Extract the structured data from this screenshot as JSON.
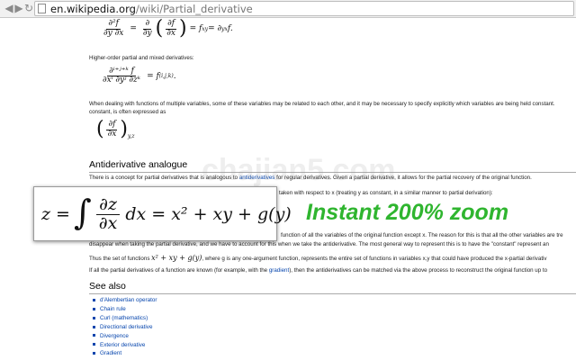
{
  "browser": {
    "url_host": "en.wikipedia.org",
    "url_path": "/wiki/Partial_derivative"
  },
  "article": {
    "eq1": {
      "d2f": "∂²f",
      "dydx": "∂y ∂x",
      "eq_sign": "=",
      "d": "∂",
      "dy": "∂y",
      "df": "∂f",
      "dx": "∂x",
      "rest": "= f",
      "sub1": "xy",
      "rest2": " = ∂",
      "sub2": "yx",
      "end": "f."
    },
    "higher_order_text": "Higher-order partial and mixed derivatives:",
    "eq2": {
      "num": "∂ⁱ⁺ʲ⁺ᵏ f",
      "den": "∂xⁱ ∂yʲ ∂zᵏ",
      "rhs": "= f",
      "sup": "(i,j,k)",
      "end": "."
    },
    "multivar_text_1": "When dealing with functions of multiple variables, some of these variables may be related to each other, and it may be necessary to specify explicitly which variables are being held constant.",
    "multivar_text_2": "constant, is often expressed as",
    "eq3": {
      "num": "∂f",
      "den": "∂x",
      "sub": "y,z"
    },
    "antiderivative_heading": "Antiderivative analogue",
    "anti_text_1_pre": "There is a concept for partial derivatives that is analogous to ",
    "anti_text_1_link": "antiderivatives",
    "anti_text_1_post": " for regular derivatives. Given a partial derivative, it allows for the partial recovery of the original function.",
    "anti_text_2": "taken with respect to x (treating y as constant, in a similar manner to partial derivation):",
    "anti_text_3": "function of all the variables of the original function except x. The reason for this is that all the other variables are tre",
    "anti_text_4": "disappear when taking the partial derivative, and we have to account for this when we take the antiderivative. The most general way to represent this is to have the \"constant\" represent an",
    "thus_pre": "Thus the set of functions ",
    "thus_math": "x² + xy + g(y)",
    "thus_post": ", where g is any one-argument function, represents the entire set of functions in variables x,y that could have produced the x-partial derivativ",
    "known_pre": "If all the partial derivatives of a function are known (for example, with the ",
    "known_link": "gradient",
    "known_post": "), then the antiderivatives can be matched via the above process to reconstruct the original function up to",
    "see_also_heading": "See also",
    "see_also": [
      "d'Alembertian operator",
      "Chain rule",
      "Curl (mathematics)",
      "Directional derivative",
      "Divergence",
      "Exterior derivative",
      "Gradient"
    ]
  },
  "zoom_overlay": {
    "lhs": "z =",
    "integral": "∫",
    "num": "∂z",
    "den": "∂x",
    "rhs": "dx = x² + xy + g(y)",
    "label": "Instant 200% zoom",
    "label_color": "#2fb52f"
  },
  "watermark": "chajian5.com"
}
